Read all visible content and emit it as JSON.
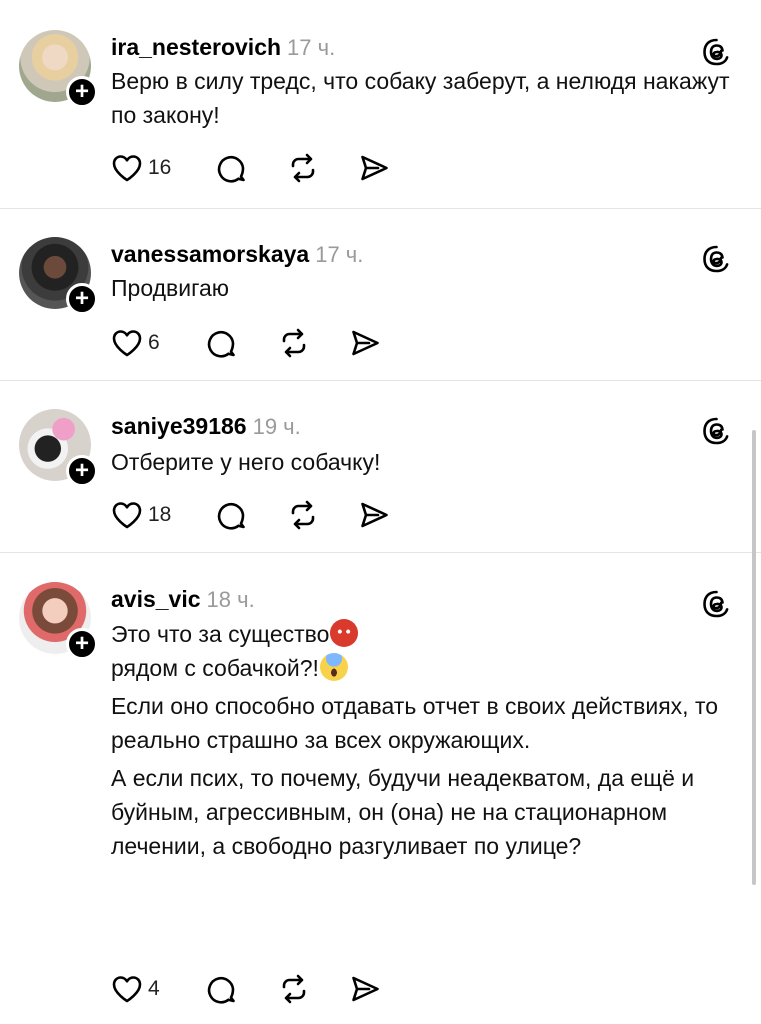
{
  "posts": [
    {
      "username": "ira_nesterovich",
      "time": "17 ч.",
      "paragraphs": [
        "Верю в силу тредс, что собаку заберут, а нелюдя накажут по закону!"
      ],
      "likes": "16"
    },
    {
      "username": "vanessamorskaya",
      "time": "17 ч.",
      "paragraphs": [
        "Продвигаю"
      ],
      "likes": "6"
    },
    {
      "username": "saniye39186",
      "time": "19 ч.",
      "paragraphs": [
        "Отберите у него собачку!"
      ],
      "likes": "18"
    },
    {
      "username": "avis_vic",
      "time": "18 ч.",
      "lines": {
        "l1": "Это что за существо",
        "l2": "рядом с собачкой?!",
        "p2": "Если оно способно отдавать отчет в своих действиях, то реально страшно за всех окружающих.",
        "p3": "А если псих, то почему, будучи неадекватом, да ещё и буйным, агрессивным, он (она) не на стационарном лечении, а свободно разгуливает по улице?"
      },
      "emojis": [
        "devil-face-emoji",
        "screaming-face-emoji"
      ],
      "likes": "4"
    }
  ],
  "icons": {
    "follow": "+",
    "threads": "threads-logo-icon",
    "like": "heart-icon",
    "reply": "comment-bubble-icon",
    "repost": "repost-icon",
    "share": "send-icon"
  },
  "colors": {
    "time": "#9a9a9a",
    "divider": "#e4e4e4"
  }
}
